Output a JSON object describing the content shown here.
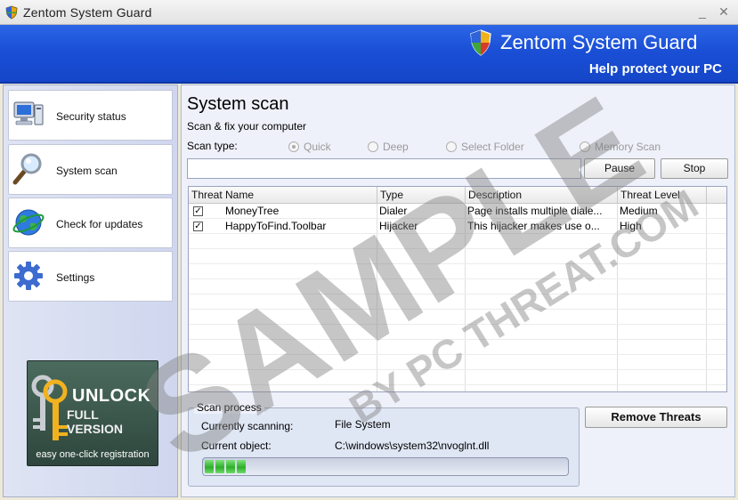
{
  "window": {
    "title": "Zentom System Guard",
    "minimize_glyph": "_",
    "close_glyph": "✕"
  },
  "header": {
    "title": "Zentom System Guard",
    "tagline": "Help protect your PC",
    "icon": "shield-icon"
  },
  "sidebar": {
    "items": [
      {
        "label": "Security status",
        "icon": "computer-icon"
      },
      {
        "label": "System scan",
        "icon": "magnifier-icon"
      },
      {
        "label": "Check for updates",
        "icon": "globe-icon"
      },
      {
        "label": "Settings",
        "icon": "gear-icon"
      }
    ],
    "unlock": {
      "line1": "UNLOCK",
      "line2": "FULL VERSION",
      "line3": "easy one-click registration",
      "icon": "keys-icon"
    }
  },
  "main": {
    "title": "System scan",
    "subtitle": "Scan & fix your computer",
    "scan_type_label": "Scan type:",
    "scan_types": [
      {
        "label": "Quick",
        "selected": true
      },
      {
        "label": "Deep",
        "selected": false
      },
      {
        "label": "Select Folder",
        "selected": false
      },
      {
        "label": "Memory Scan",
        "selected": false
      }
    ],
    "scan_path_value": "",
    "pause_label": "Pause",
    "stop_label": "Stop",
    "table": {
      "columns": [
        "Threat Name",
        "Type",
        "Description",
        "Threat Level"
      ],
      "rows": [
        {
          "checked": true,
          "name": "MoneyTree",
          "type": "Dialer",
          "description": "Page installs multiple diale...",
          "level": "Medium"
        },
        {
          "checked": true,
          "name": "HappyToFind.Toolbar",
          "type": "Hijacker",
          "description": "This hijacker makes use o...",
          "level": "High"
        }
      ]
    },
    "scan_process": {
      "legend": "Scan process",
      "currently_label": "Currently scanning:",
      "currently_value": "File System",
      "object_label": "Current object:",
      "object_value": "C:\\windows\\system32\\nvoglnt.dll",
      "progress_fraction": 0.12
    },
    "remove_label": "Remove Threats"
  },
  "watermark": {
    "line1": "SAMPLE",
    "line2": "BY PC THREAT.COM"
  },
  "colors": {
    "header_blue": "#1a4fd6",
    "progress_green": "#2eae2a",
    "panel_bg": "#eef1f9"
  }
}
